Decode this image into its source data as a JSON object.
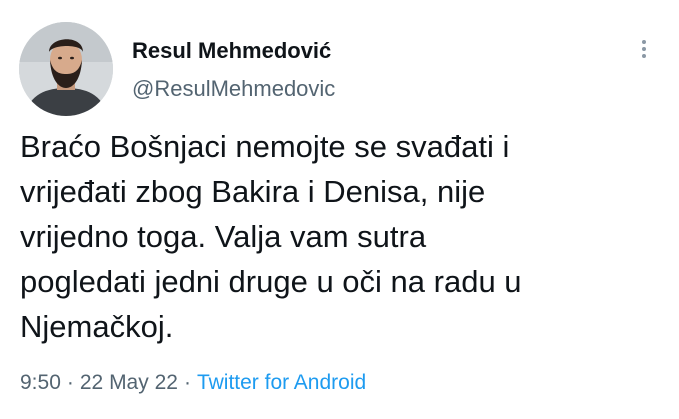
{
  "author": {
    "name": "Resul Mehmedović",
    "handle": "@ResulMehmedovic",
    "avatar_icon": "profile-photo"
  },
  "more_icon": "vertical-ellipsis-icon",
  "tweet": {
    "lines": [
      "Braćo Bošnjaci nemojte se svađati i",
      "vrijeđati zbog Bakira i Denisa, nije",
      "vrijedno toga. Valja vam sutra",
      "pogledati jedni druge u oči na radu u",
      "Njemačkoj."
    ]
  },
  "meta": {
    "time": "9:50",
    "separator": "·",
    "date": "22 May 22",
    "source": "Twitter for Android"
  },
  "colors": {
    "text": "#0f1419",
    "secondary": "#536471",
    "link": "#1d9bf0"
  }
}
